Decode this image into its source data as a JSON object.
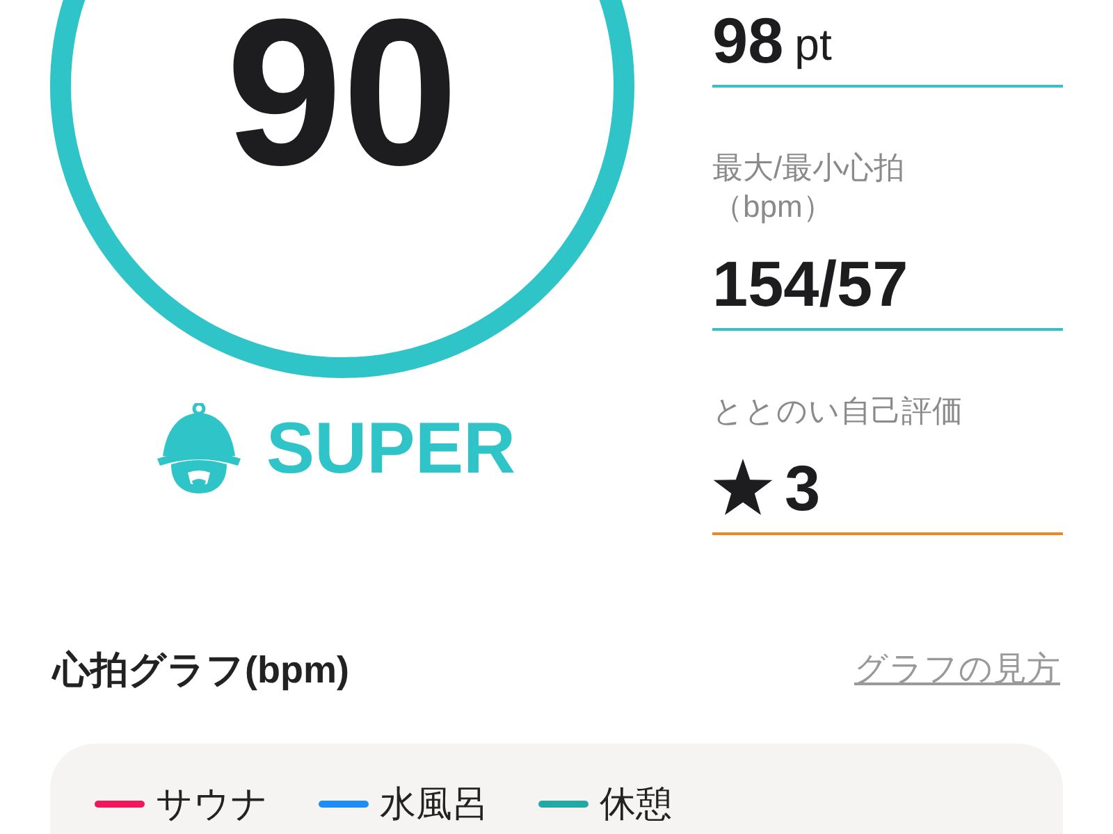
{
  "score": {
    "value": "90",
    "rank": "SUPER"
  },
  "stats": [
    {
      "kind": "value",
      "value": "98",
      "unit": "pt",
      "color": "#3bbfc6"
    },
    {
      "kind": "value",
      "label": [
        "最大/最小心拍",
        "（bpm）"
      ],
      "value": "154/57",
      "color": "#3bbfc6"
    },
    {
      "kind": "rating",
      "label": [
        "ととのい自己評価"
      ],
      "value": "3",
      "color": "#e8862a"
    }
  ],
  "graph": {
    "title": "心拍グラフ(bpm)",
    "help_link": "グラフの見方",
    "legend": [
      {
        "label": "サウナ",
        "color": "#f0185a"
      },
      {
        "label": "水風呂",
        "color": "#1e8ef5"
      },
      {
        "label": "休憩",
        "color": "#22a9a3"
      }
    ]
  }
}
